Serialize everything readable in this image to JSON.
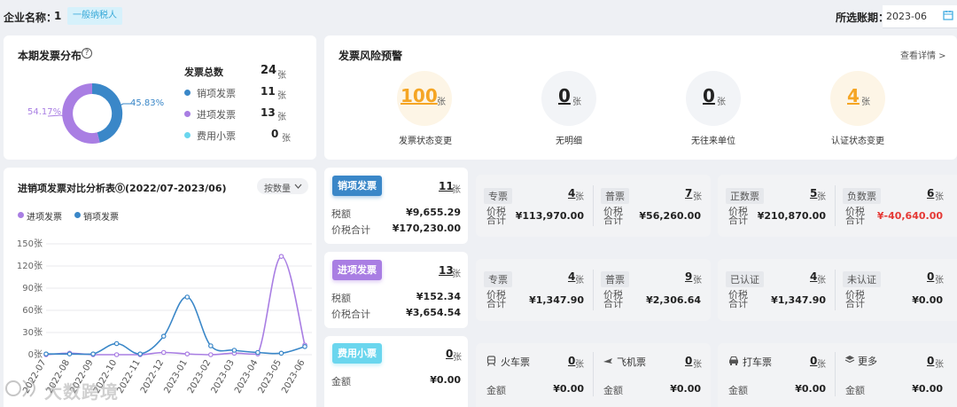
{
  "header": {
    "company_label": "企业名称：",
    "company_name": "1",
    "taxpayer_type": "一般纳税人",
    "period_label": "所选账期：",
    "period_value": "2023-06"
  },
  "distribution": {
    "title": "本期发票分布",
    "total_label": "发票总数",
    "total_value": "24",
    "unit": "张",
    "items": [
      {
        "label": "销项发票",
        "value": "11",
        "color": "#3a87c8"
      },
      {
        "label": "进项发票",
        "value": "13",
        "color": "#a97ee3"
      },
      {
        "label": "费用小票",
        "value": "0",
        "color": "#6ad6ee"
      }
    ],
    "pct_left": "54.17%",
    "pct_right": "45.83%"
  },
  "risk": {
    "title": "发票风险预警",
    "detail_link": "查看详情 >",
    "items": [
      {
        "value": "100",
        "unit": "张",
        "label": "发票状态变更",
        "color": "#f5a524",
        "bg": "#fdf5e6"
      },
      {
        "value": "0",
        "unit": "张",
        "label": "无明细",
        "color": "#222",
        "bg": "#f2f4f7"
      },
      {
        "value": "0",
        "unit": "张",
        "label": "无往来单位",
        "color": "#222",
        "bg": "#f2f4f7"
      },
      {
        "value": "4",
        "unit": "张",
        "label": "认证状态变更",
        "color": "#f5a524",
        "bg": "#fdf5e6"
      }
    ]
  },
  "compare": {
    "title": "进销项发票对比分析表⓪(2022/07-2023/06)",
    "sort_label": "按数量",
    "legend": [
      {
        "label": "进项发票",
        "color": "#a97ee3"
      },
      {
        "label": "销项发票",
        "color": "#3a87c8"
      }
    ]
  },
  "chart_data": {
    "type": "line",
    "categories": [
      "2022-07",
      "2022-08",
      "2022-09",
      "2022-10",
      "2022-11",
      "2022-12",
      "2023-01",
      "2023-02",
      "2023-03",
      "2023-04",
      "2023-05",
      "2023-06"
    ],
    "series": [
      {
        "name": "进项发票",
        "color": "#a97ee3",
        "values": [
          0,
          2,
          0,
          0,
          0,
          3,
          1,
          0,
          2,
          1,
          133,
          13
        ]
      },
      {
        "name": "销项发票",
        "color": "#3a87c8",
        "values": [
          1,
          1,
          1,
          15,
          1,
          25,
          78,
          12,
          6,
          3,
          2,
          11
        ]
      }
    ],
    "y_ticks": [
      "150张",
      "120张",
      "90张",
      "60张",
      "30张",
      "0张"
    ],
    "ylim": [
      0,
      150
    ],
    "grid": true,
    "legend_position": "top-left"
  },
  "sales": {
    "badge": "销项发票",
    "count": "11",
    "unit": "张",
    "tax_label": "税额",
    "tax_value": "¥9,655.29",
    "total_label": "价税合计",
    "total_value": "¥170,230.00",
    "cells": [
      {
        "tag": "专票",
        "count": "4",
        "amount": "¥113,970.00"
      },
      {
        "tag": "普票",
        "count": "7",
        "amount": "¥56,260.00"
      },
      {
        "tag": "正数票",
        "count": "5",
        "amount": "¥210,870.00"
      },
      {
        "tag": "负数票",
        "count": "6",
        "amount": "¥-40,640.00"
      }
    ],
    "cell_label": "价税合计"
  },
  "purchase": {
    "badge": "进项发票",
    "count": "13",
    "unit": "张",
    "tax_label": "税额",
    "tax_value": "¥152.34",
    "total_label": "价税合计",
    "total_value": "¥3,654.54",
    "cells": [
      {
        "tag": "专票",
        "count": "4",
        "amount": "¥1,347.90"
      },
      {
        "tag": "普票",
        "count": "9",
        "amount": "¥2,306.64"
      },
      {
        "tag": "已认证",
        "count": "4",
        "amount": "¥1,347.90"
      },
      {
        "tag": "未认证",
        "count": "0",
        "amount": "¥0.00"
      }
    ],
    "cell_label": "价税合计"
  },
  "expense": {
    "badge": "费用小票",
    "count": "0",
    "unit": "张",
    "amount_label": "金额",
    "amount_value": "¥0.00",
    "cells": [
      {
        "label": "火车票",
        "icon": "train-icon",
        "count": "0",
        "amount": "¥0.00"
      },
      {
        "label": "飞机票",
        "icon": "plane-icon",
        "count": "0",
        "amount": "¥0.00"
      },
      {
        "label": "打车票",
        "icon": "taxi-icon",
        "count": "0",
        "amount": "¥0.00"
      },
      {
        "label": "更多",
        "icon": "layers-icon",
        "count": "0",
        "amount": "¥0.00"
      }
    ],
    "cell_label": "金额"
  },
  "watermark": "大数跨境"
}
